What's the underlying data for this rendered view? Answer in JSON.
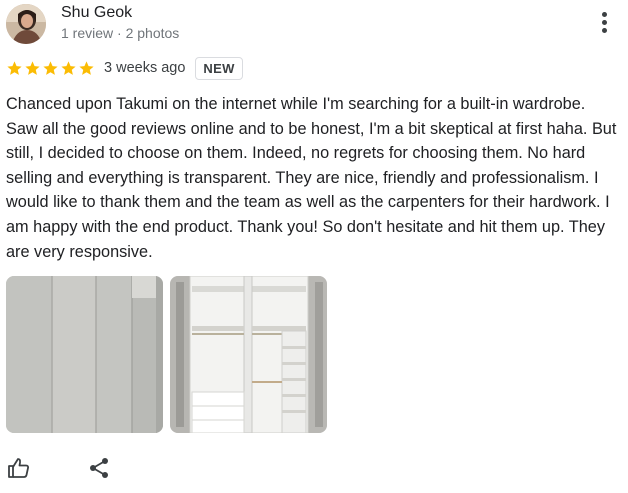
{
  "reviewer": {
    "name": "Shu Geok",
    "meta": "1 review · 2 photos",
    "avatar_icon": "reviewer-avatar"
  },
  "rating": {
    "stars": 5,
    "max_stars": 5,
    "star_color": "#fbbc04",
    "time_ago": "3 weeks ago",
    "badge": "NEW"
  },
  "review_text": "Chanced upon Takumi on the internet while I'm searching for a built-in wardrobe. Saw all the good reviews online and to be honest, I'm a bit skeptical at first haha. But still, I decided to choose on them. Indeed, no regrets for choosing them. No hard selling and everything is transparent. They are nice, friendly and professionalism. I would like to thank them and the team as well as the carpenters for their hardwork. I am happy with the end product. Thank you! So don't hesitate and hit them up. They are very responsive.",
  "photos": [
    {
      "name": "closed-wardrobe-photo"
    },
    {
      "name": "open-wardrobe-photo"
    }
  ],
  "actions": {
    "like_icon": "thumbs-up-icon",
    "share_icon": "share-icon",
    "more_icon": "more-vertical-icon"
  }
}
